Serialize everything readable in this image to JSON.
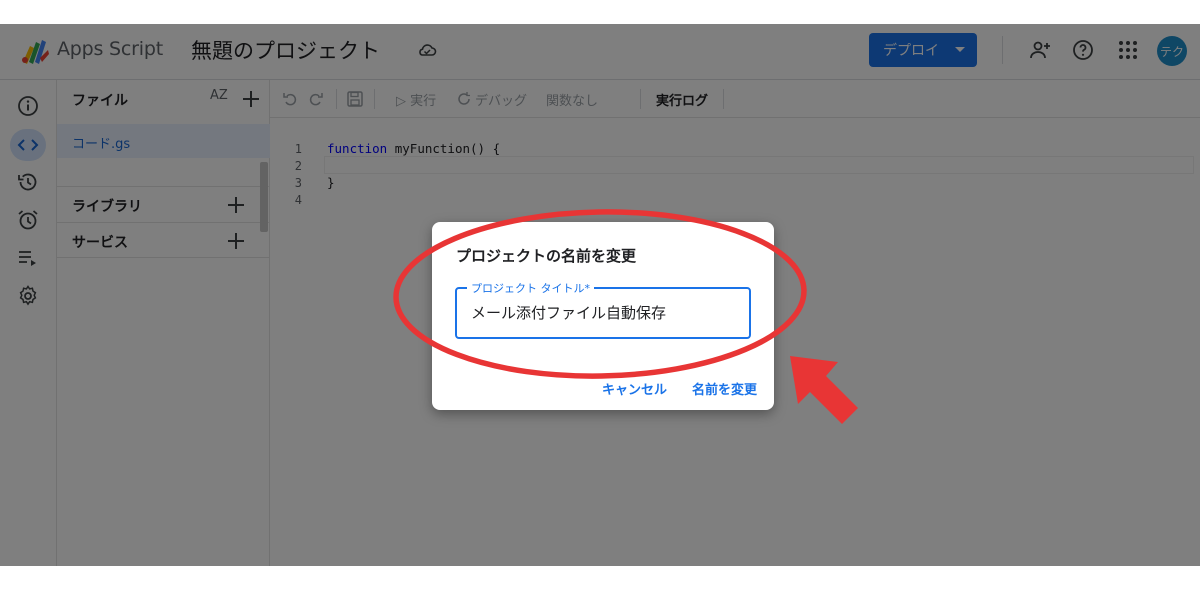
{
  "header": {
    "brand": "Apps Script",
    "project_title": "無題のプロジェクト",
    "deploy_label": "デプロイ",
    "avatar_initials": "テク"
  },
  "files": {
    "heading": "ファイル",
    "sort_label": "AZ",
    "items": [
      {
        "name": "コード.gs"
      }
    ],
    "sections": [
      {
        "label": "ライブラリ"
      },
      {
        "label": "サービス"
      }
    ]
  },
  "toolbar": {
    "run_label": "▷ 実行",
    "debug_label": "デバッグ",
    "function_label": "関数なし",
    "log_label": "実行ログ"
  },
  "editor": {
    "line_numbers": [
      "1",
      "2",
      "3",
      "4"
    ],
    "code_lines": {
      "keyword": "function",
      "decl": " myFunction() {",
      "close": "}"
    }
  },
  "dialog": {
    "title": "プロジェクトの名前を変更",
    "field_label": "プロジェクト タイトル*",
    "field_value": "メール添付ファイル自動保存",
    "cancel_label": "キャンセル",
    "confirm_label": "名前を変更"
  },
  "colors": {
    "accent": "#1a73e8",
    "annotation": "#e83535",
    "avatar": "#1e8ecb"
  }
}
